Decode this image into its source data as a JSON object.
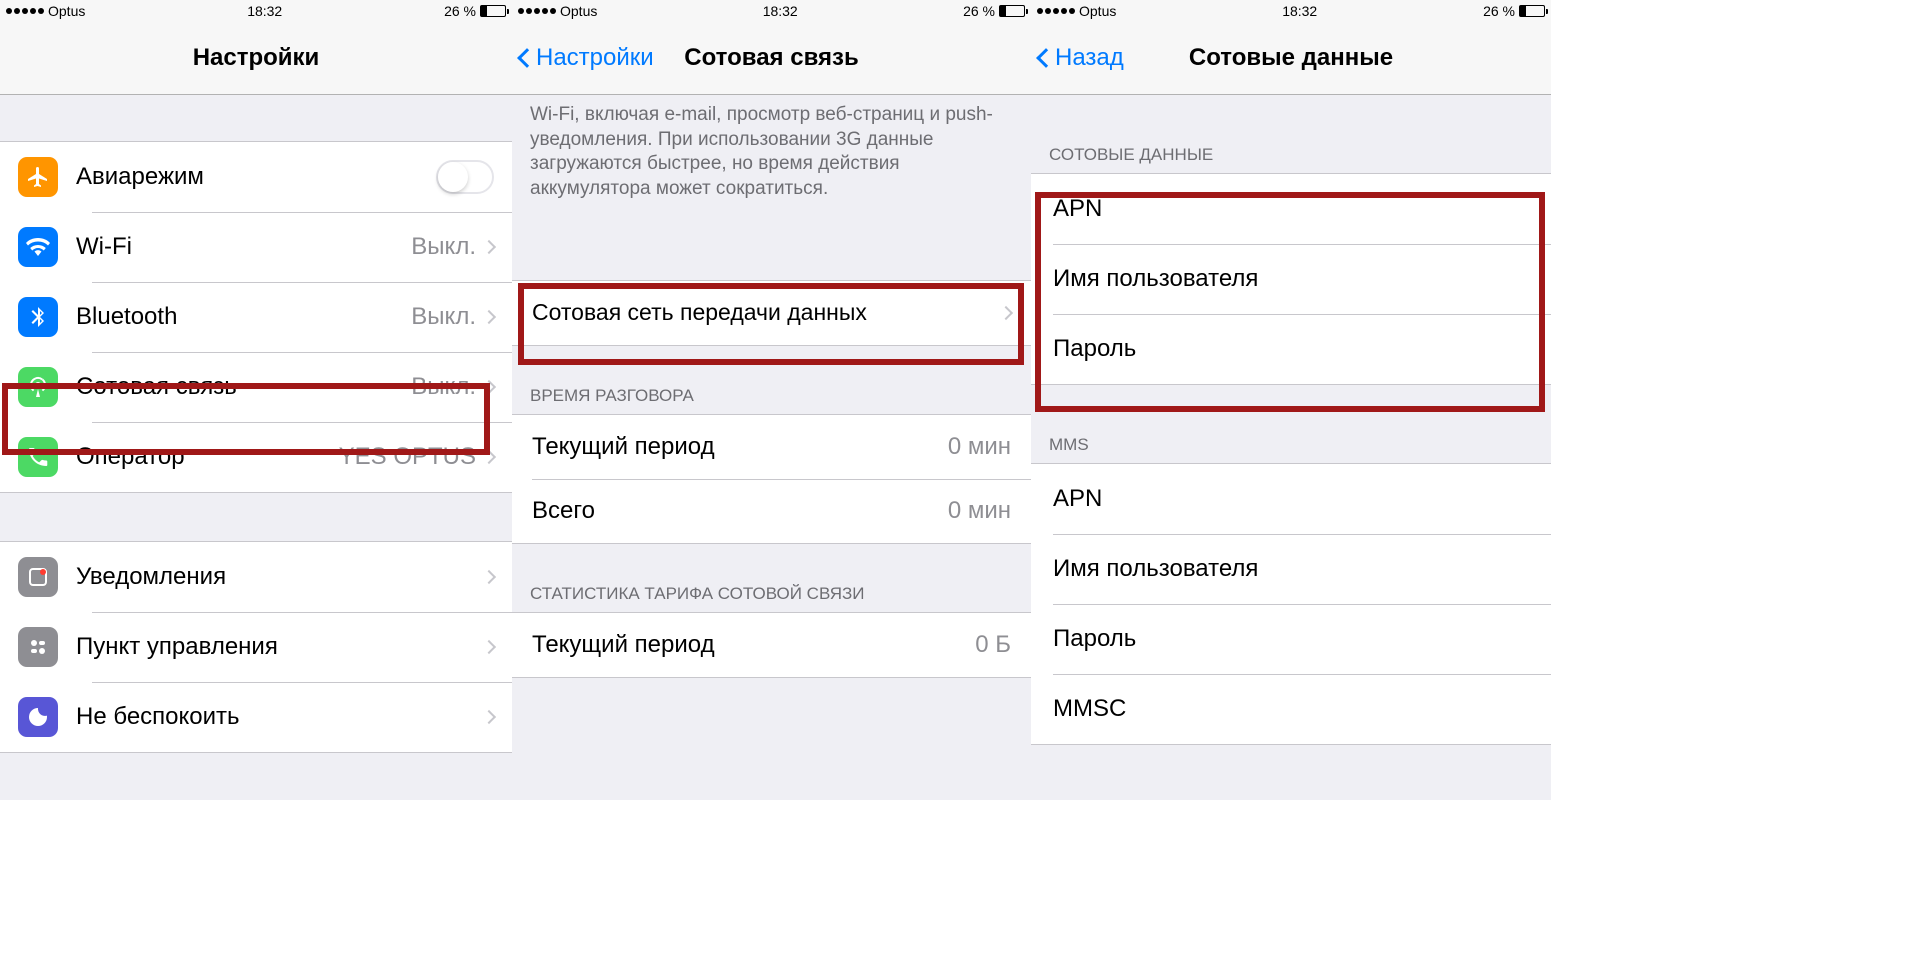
{
  "status": {
    "carrier": "Optus",
    "time": "18:32",
    "battery": "26 %"
  },
  "screen1": {
    "title": "Настройки",
    "rows": {
      "airplane": "Авиарежим",
      "wifi": "Wi-Fi",
      "wifi_val": "Выкл.",
      "bluetooth": "Bluetooth",
      "bluetooth_val": "Выкл.",
      "cellular": "Сотовая связь",
      "cellular_val": "Выкл.",
      "carrier": "Оператор",
      "carrier_val": "YES OPTUS",
      "notifications": "Уведомления",
      "control": "Пункт управления",
      "dnd": "Не беспокоить"
    }
  },
  "screen2": {
    "back": "Настройки",
    "title": "Сотовая связь",
    "footer_text": "Wi-Fi, включая e-mail, просмотр веб-страниц и push-уведомления. При использовании 3G данные загружаются быстрее, но время действия аккумулятора может сократиться.",
    "cell_network": "Сотовая сеть передачи данных",
    "talk_header": "ВРЕМЯ РАЗГОВОРА",
    "current_period": "Текущий период",
    "current_val": "0 мин",
    "total": "Всего",
    "total_val": "0 мин",
    "stats_header": "СТАТИСТИКА ТАРИФА СОТОВОЙ СВЯЗИ",
    "stats_period": "Текущий период",
    "stats_val": "0 Б"
  },
  "screen3": {
    "back": "Назад",
    "title": "Сотовые данные",
    "section1_header": "СОТОВЫЕ ДАННЫЕ",
    "apn": "APN",
    "username": "Имя пользователя",
    "password": "Пароль",
    "section2_header": "MMS",
    "mms_apn": "APN",
    "mms_username": "Имя пользователя",
    "mms_password": "Пароль",
    "mmsc": "MMSC"
  }
}
